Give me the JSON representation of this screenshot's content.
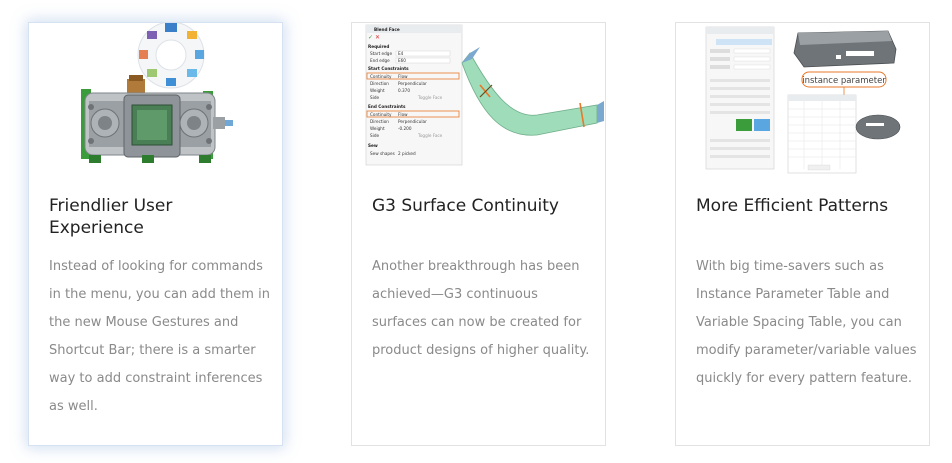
{
  "cards": [
    {
      "title": "Friendlier User Experience",
      "description": "Instead of looking for commands in the menu, you can add them in the new Mouse Gestures and Shortcut Bar; there is a smarter way to add constraint inferences as well.",
      "image_icon": "mechanical-gearbox-with-gesture-wheel"
    },
    {
      "title": "G3 Surface Continuity",
      "description": "Another breakthrough has been achieved—G3 continuous surfaces can now be created for product designs of higher quality.",
      "image_icon": "blend-face-panel-and-curved-surface",
      "panel": {
        "title": "Blend Face",
        "required": "Required",
        "start_edge_label": "Start edge",
        "start_edge_value": "E4",
        "end_edge_label": "End edge",
        "end_edge_value": "E60",
        "start_constraints": "Start Constraints",
        "end_constraints": "End Constraints",
        "continuity_label": "Continuity",
        "continuity_value": "Flow",
        "direction_label": "Direction",
        "direction_value": "Perpendicular",
        "weight_label": "Weight",
        "start_weight": "0.370",
        "end_weight": "-0.200",
        "side_label": "Side",
        "toggle_face": "Toggle Face",
        "sew": "Sew",
        "sew_shapes": "Sew shapes",
        "sew_value": "2 picked"
      }
    },
    {
      "title": "More Efficient Patterns",
      "description": "With big time-savers such as Instance Parameter Table and Variable Spacing Table, you can modify parameter/variable values quickly for every pattern feature.",
      "image_icon": "pattern-panel-with-instance-parameter",
      "callout": "instance parameter"
    }
  ],
  "colors": {
    "title": "#222222",
    "description": "#8a8a8a",
    "card_border": "#e2e2e2",
    "active_glow": "#a9c2e4",
    "accent_orange": "#e8782a",
    "surface_green": "#9fdcb9",
    "gear_green": "#3a9c3a"
  }
}
